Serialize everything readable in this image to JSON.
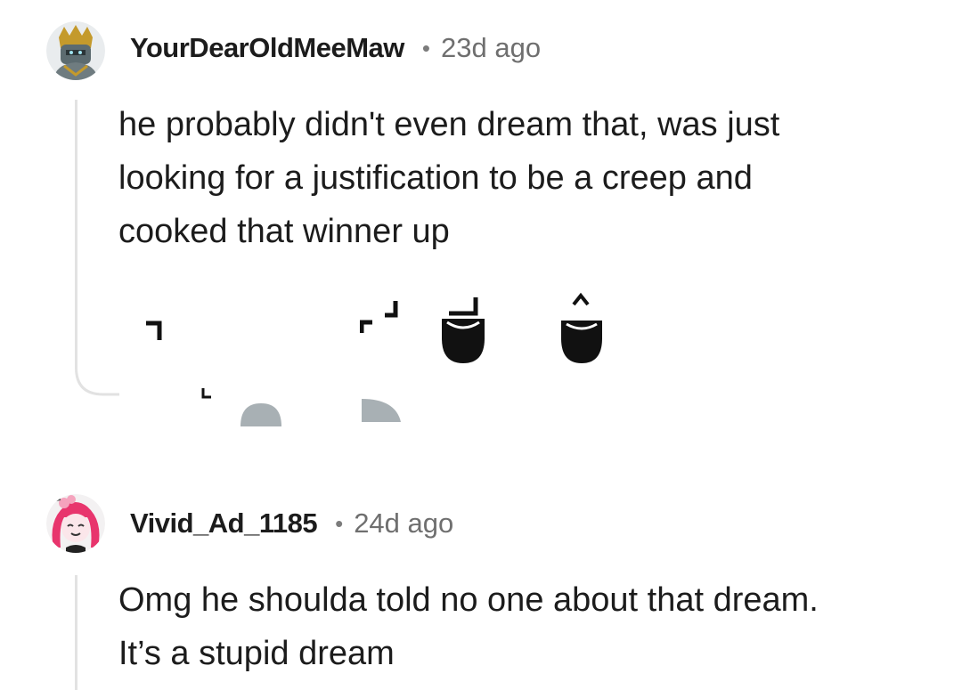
{
  "comments": [
    {
      "username": "YourDearOldMeeMaw",
      "separator": "•",
      "time": "23d ago",
      "avatar_icon": "armored-knight-avatar",
      "body": [
        "he probably didn't even dream that, was just",
        "looking for a justification to be a creep and",
        "cooked that winner up"
      ]
    },
    {
      "username": "Vivid_Ad_1185",
      "separator": "•",
      "time": "24d ago",
      "avatar_icon": "pink-haired-avatar",
      "body": [
        "Omg he shoulda told no one about that dream.",
        "It’s a stupid dream"
      ]
    }
  ],
  "colors": {
    "text": "#1c1c1c",
    "meta": "#6f6f6f",
    "thread_line": "#e2e2e2",
    "icon_dark": "#111111",
    "icon_grey": "#a8b0b4"
  }
}
